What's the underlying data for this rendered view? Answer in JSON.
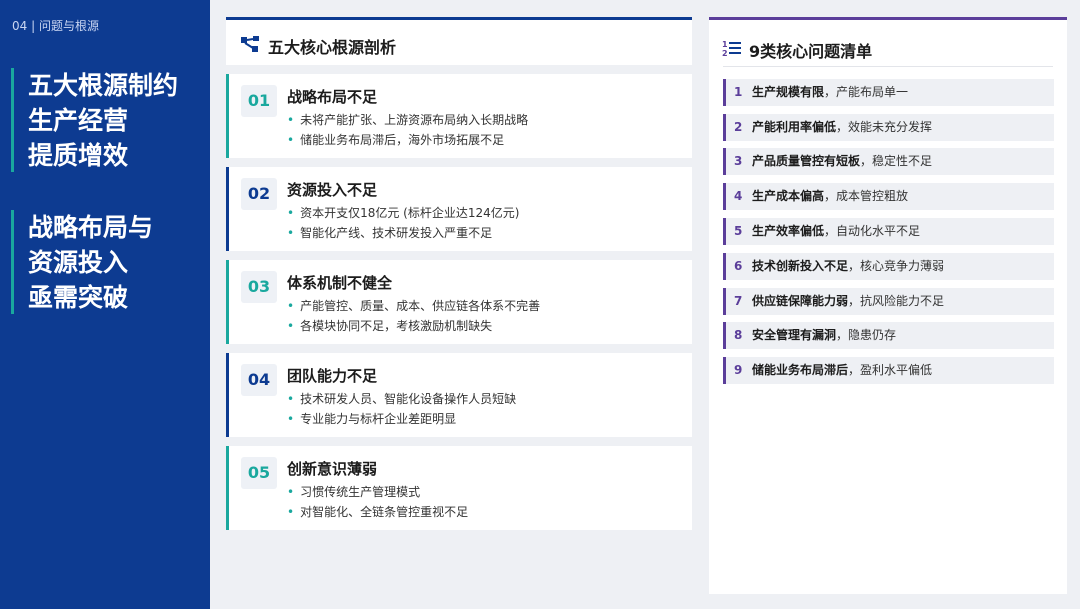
{
  "sidebar": {
    "section_tag": "04 | 问题与根源",
    "headline_top": [
      "五大根源制约",
      "生产经营",
      "提质增效"
    ],
    "headline_bottom": [
      "战略布局与",
      "资源投入",
      "亟需突破"
    ]
  },
  "middle": {
    "title": "五大核心根源剖析",
    "cards": [
      {
        "num": "01",
        "title": "战略布局不足",
        "bullets": [
          "未将产能扩张、上游资源布局纳入长期战略",
          "储能业务布局滞后，海外市场拓展不足"
        ]
      },
      {
        "num": "02",
        "title": "资源投入不足",
        "bullets": [
          "资本开支仅18亿元 (标杆企业达124亿元)",
          "智能化产线、技术研发投入严重不足"
        ]
      },
      {
        "num": "03",
        "title": "体系机制不健全",
        "bullets": [
          "产能管控、质量、成本、供应链各体系不完善",
          "各模块协同不足，考核激励机制缺失"
        ]
      },
      {
        "num": "04",
        "title": "团队能力不足",
        "bullets": [
          "技术研发人员、智能化设备操作人员短缺",
          "专业能力与标杆企业差距明显"
        ]
      },
      {
        "num": "05",
        "title": "创新意识薄弱",
        "bullets": [
          "习惯传统生产管理模式",
          "对智能化、全链条管控重视不足"
        ]
      }
    ]
  },
  "right": {
    "title": "9类核心问题清单",
    "issues": [
      {
        "idx": "1",
        "strong": "生产规模有限",
        "rest": "，产能布局单一"
      },
      {
        "idx": "2",
        "strong": "产能利用率偏低",
        "rest": "，效能未充分发挥"
      },
      {
        "idx": "3",
        "strong": "产品质量管控有短板",
        "rest": "，稳定性不足"
      },
      {
        "idx": "4",
        "strong": "生产成本偏高",
        "rest": "，成本管控粗放"
      },
      {
        "idx": "5",
        "strong": "生产效率偏低",
        "rest": "，自动化水平不足"
      },
      {
        "idx": "6",
        "strong": "技术创新投入不足",
        "rest": "，核心竞争力薄弱"
      },
      {
        "idx": "7",
        "strong": "供应链保障能力弱",
        "rest": "，抗风险能力不足"
      },
      {
        "idx": "8",
        "strong": "安全管理有漏洞",
        "rest": "，隐患仍存"
      },
      {
        "idx": "9",
        "strong": "储能业务布局滞后",
        "rest": "，盈利水平偏低"
      }
    ]
  },
  "colors": {
    "navy": "#0d3b91",
    "teal": "#1aa89e",
    "purple": "#5b3e9a"
  },
  "icons": {
    "middle_title": "network-nodes-icon",
    "right_title": "numbered-list-icon"
  }
}
